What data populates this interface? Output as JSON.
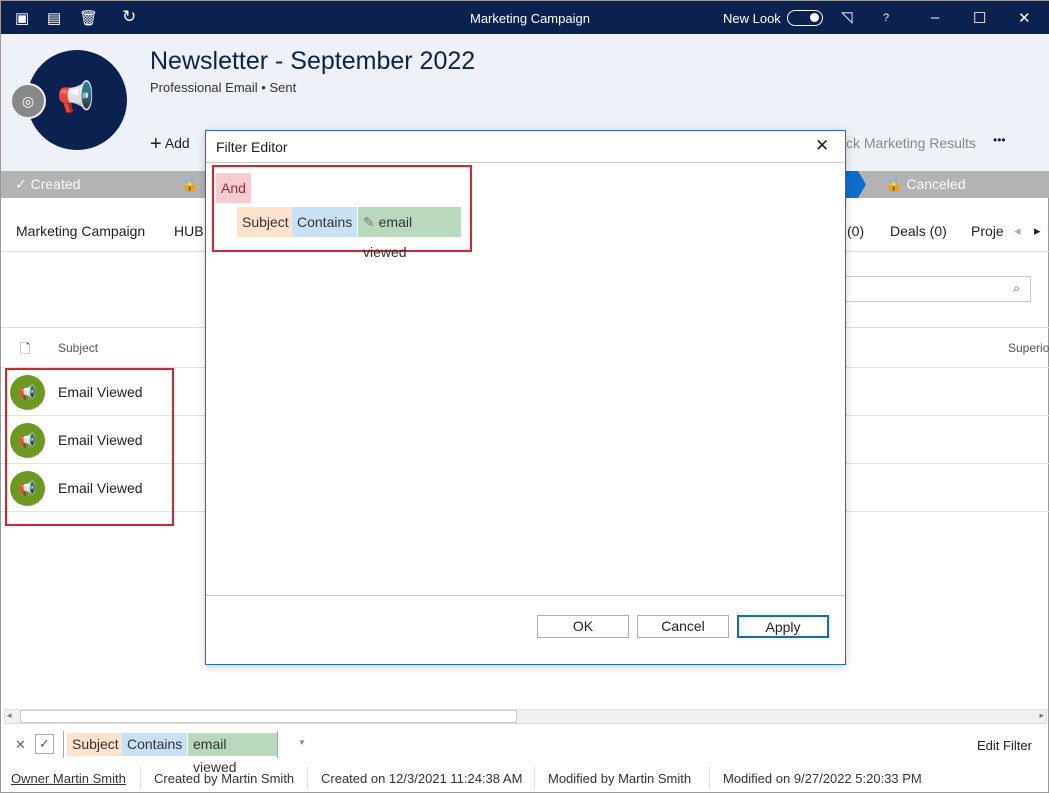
{
  "window": {
    "title": "Marketing Campaign",
    "new_look_label": "New Look",
    "help": "?"
  },
  "header": {
    "title": "Newsletter - September 2022",
    "subtitle": "Professional Email",
    "status": "Sent",
    "add_label": "Add",
    "action_label": "ck Marketing Results",
    "more": "•••"
  },
  "stages": [
    {
      "label": "Created",
      "state": "done"
    },
    {
      "label": "Canceled",
      "state": "locked"
    }
  ],
  "tabs": [
    "Marketing Campaign",
    "HUB",
    "(0)",
    "Deals (0)",
    "Proje"
  ],
  "grid": {
    "columns": [
      "Subject",
      "Superio"
    ],
    "rows": [
      {
        "subject": "Email Viewed"
      },
      {
        "subject": "Email Viewed"
      },
      {
        "subject": "Email Viewed"
      }
    ]
  },
  "dialog": {
    "title": "Filter Editor",
    "group_operator": "And",
    "condition": {
      "field": "Subject",
      "operator": "Contains",
      "value": "email viewed"
    },
    "ok": "OK",
    "cancel": "Cancel",
    "apply": "Apply"
  },
  "filter_bar": {
    "field": "Subject",
    "operator": "Contains",
    "value": "email viewed",
    "edit_label": "Edit Filter"
  },
  "status": {
    "owner": "Owner Martin Smith",
    "created_by": "Created by Martin Smith",
    "created_on": "Created on 12/3/2021 11:24:38 AM",
    "modified_by": "Modified by Martin Smith",
    "modified_on": "Modified on 9/27/2022 5:20:33 PM"
  },
  "colors": {
    "titlebar": "#0b2150",
    "accent": "#0a6fc9",
    "chip_field": "#fde3cc",
    "chip_operator": "#c8e1f5",
    "chip_value": "#b9d9bd",
    "chip_group": "#f7cbcf",
    "highlight": "#e0202a",
    "activity_icon": "#6a9a1f"
  }
}
